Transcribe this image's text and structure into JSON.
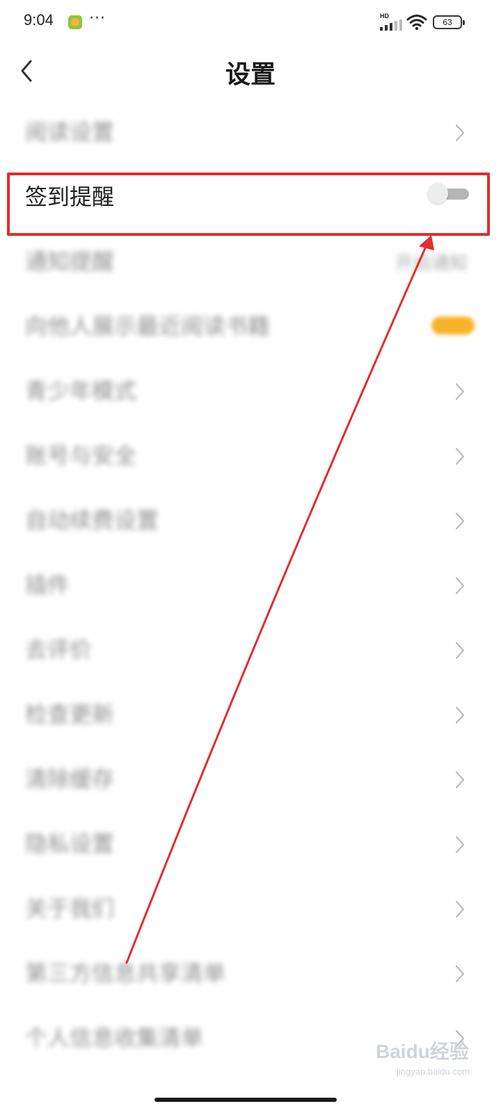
{
  "status_bar": {
    "time": "9:04",
    "more": "···",
    "network_badge": "HD",
    "battery": "63"
  },
  "header": {
    "title": "设置"
  },
  "settings": {
    "items": [
      {
        "label": "阅读设置",
        "control": "chevron",
        "blurred": true
      },
      {
        "label": "签到提醒",
        "control": "toggle",
        "toggle_on": false,
        "blurred": false
      },
      {
        "label": "通知提醒",
        "control": "value",
        "value": "开启通知",
        "blurred": true
      },
      {
        "label": "向他人展示最近阅读书籍",
        "control": "switch-on",
        "blurred": true
      },
      {
        "label": "青少年模式",
        "control": "chevron",
        "blurred": true
      },
      {
        "label": "账号与安全",
        "control": "chevron",
        "blurred": true
      },
      {
        "label": "自动续费设置",
        "control": "chevron",
        "blurred": true
      },
      {
        "label": "插件",
        "control": "chevron",
        "blurred": true
      },
      {
        "label": "去评价",
        "control": "chevron",
        "blurred": true
      },
      {
        "label": "检查更新",
        "control": "chevron",
        "blurred": true
      },
      {
        "label": "清除缓存",
        "control": "chevron",
        "blurred": true
      },
      {
        "label": "隐私设置",
        "control": "chevron",
        "blurred": true
      },
      {
        "label": "关于我们",
        "control": "chevron",
        "blurred": true
      },
      {
        "label": "第三方信息共享清单",
        "control": "chevron",
        "blurred": true
      },
      {
        "label": "个人信息收集清单",
        "control": "chevron",
        "blurred": true
      }
    ]
  },
  "annotation": {
    "highlight_color": "#e42c2c"
  },
  "watermark": {
    "text": "Baidu经验",
    "sub": "jingyan.baidu.com"
  },
  "colors": {
    "text": "#222222",
    "chevron": "#bbbbbb",
    "toggle_track": "#b5b5b5",
    "toggle_knob": "#ededed",
    "badge": "#f6b42a"
  }
}
